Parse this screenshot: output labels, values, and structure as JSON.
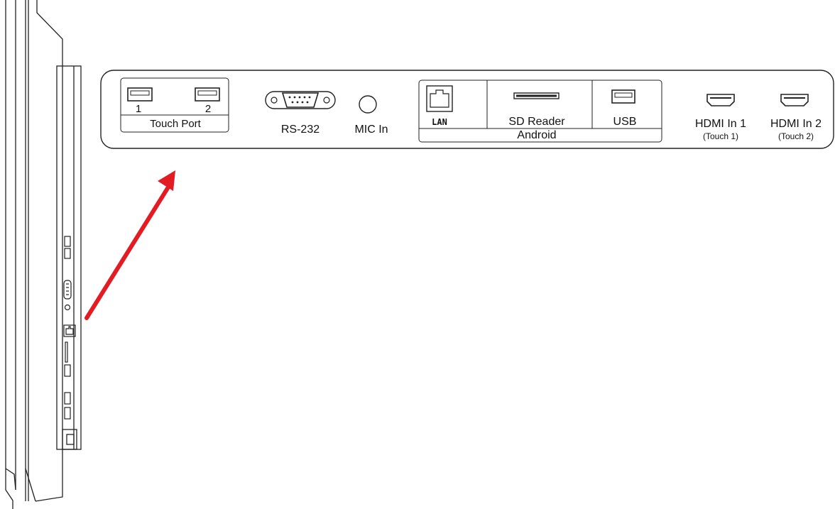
{
  "colors": {
    "line": "#222222",
    "arrow": "#e31b23",
    "background": "#ffffff"
  },
  "panel": {
    "touch_port": {
      "label": "Touch Port",
      "port_numbers": [
        "1",
        "2"
      ],
      "icon": "usb-a-icon"
    },
    "rs232": {
      "label": "RS-232",
      "icon": "db9-serial-icon"
    },
    "mic_in": {
      "label": "MIC In",
      "icon": "audio-jack-icon"
    },
    "android_group": {
      "label": "Android",
      "lan": {
        "label": "LAN",
        "icon": "ethernet-icon"
      },
      "sd_reader": {
        "label": "SD Reader",
        "icon": "sd-slot-icon"
      },
      "usb": {
        "label": "USB",
        "icon": "usb-a-icon"
      }
    },
    "hdmi_1": {
      "label": "HDMI In 1",
      "sub_label": "(Touch 1)",
      "icon": "hdmi-icon"
    },
    "hdmi_2": {
      "label": "HDMI In 2",
      "sub_label": "(Touch 2)",
      "icon": "hdmi-icon"
    }
  },
  "side_view": {
    "icons": [
      "usb-a-icon",
      "usb-a-icon",
      "db9-serial-icon",
      "audio-jack-icon",
      "ethernet-icon",
      "sd-slot-icon",
      "usb-a-icon",
      "hdmi-icon",
      "hdmi-icon"
    ]
  },
  "callout": {
    "icon": "arrow-icon"
  }
}
